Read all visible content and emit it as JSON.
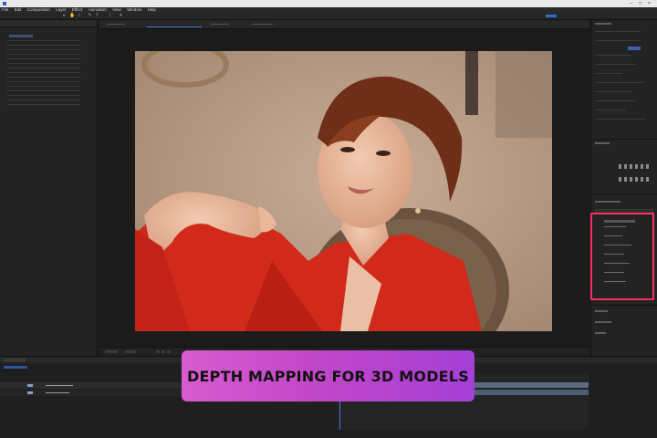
{
  "menu": [
    "File",
    "Edit",
    "Composition",
    "Layer",
    "Effect",
    "Animation",
    "View",
    "Window",
    "Help"
  ],
  "banner": {
    "text": "DEPTH MAPPING FOR 3D MODELS"
  },
  "colors": {
    "highlight": "#ff2a68",
    "banner_start": "#d85bd0",
    "banner_end": "#a43fd6",
    "background": "#1d1d1d"
  },
  "icons": [
    "selection-tool-icon",
    "hand-tool-icon",
    "zoom-tool-icon",
    "pen-tool-icon",
    "text-tool-icon",
    "brush-tool-icon",
    "puppet-tool-icon"
  ]
}
